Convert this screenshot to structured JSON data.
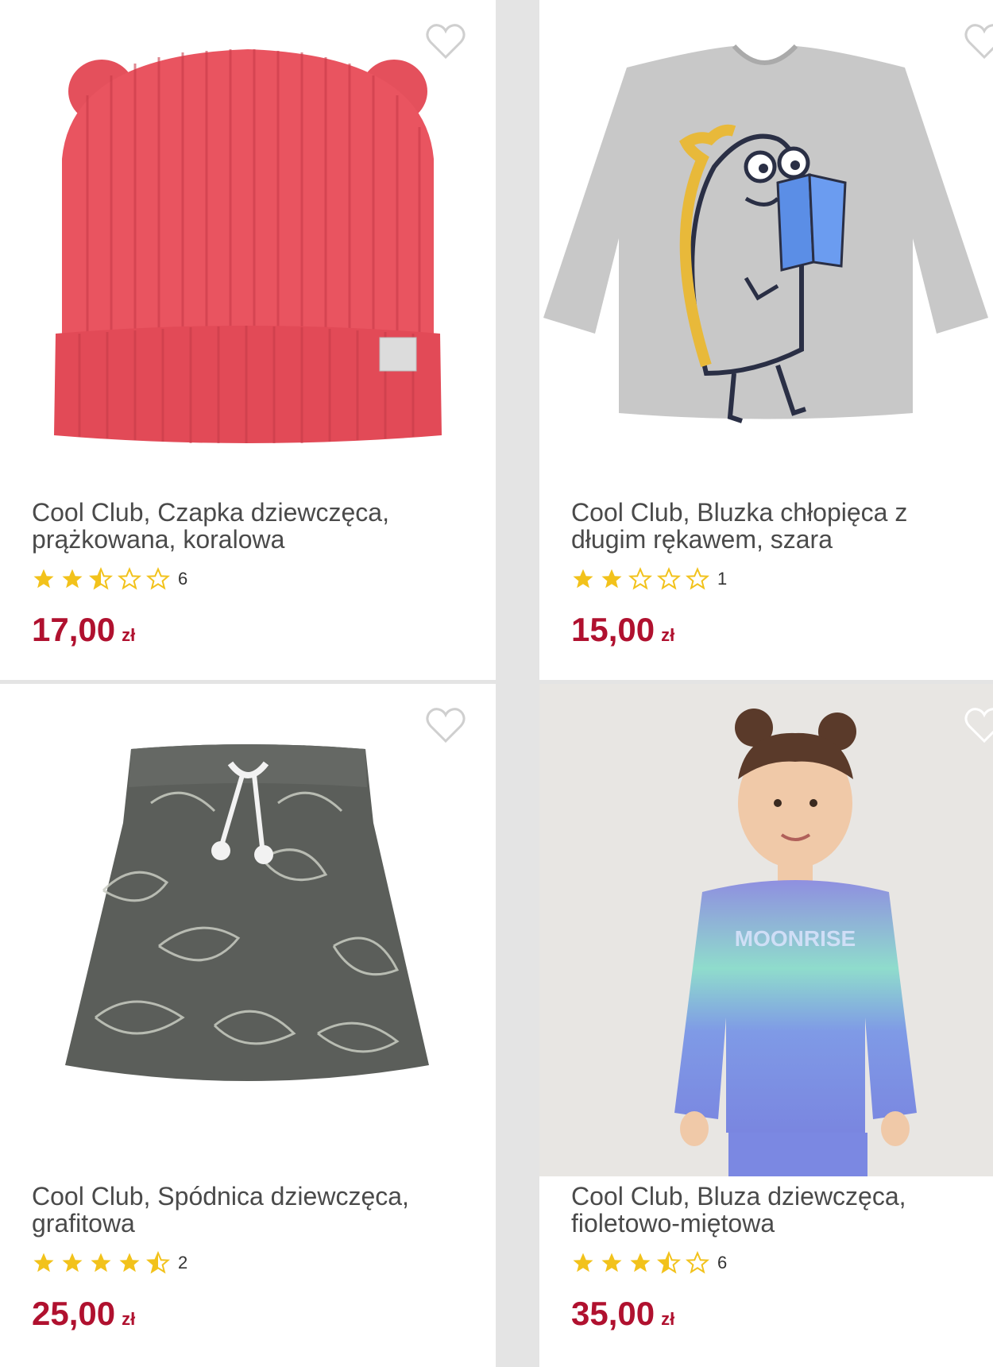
{
  "products": [
    {
      "title_line1": "Cool Club, Czapka dziewczęca,",
      "title_line2": "prążkowana, koralowa",
      "rating": 2.5,
      "review_count": "6",
      "price": "17,00",
      "currency": "zł",
      "image": "coral-knit-hat-with-ears"
    },
    {
      "title_line1": "Cool Club, Bluzka chłopięca z",
      "title_line2": "długim rękawem, szara",
      "rating": 2,
      "review_count": "1",
      "price": "15,00",
      "currency": "zł",
      "image": "grey-longsleeve-dino-reading"
    },
    {
      "title_line1": "Cool Club, Spódnica dziewczęca,",
      "title_line2": "grafitowa",
      "rating": 4.5,
      "review_count": "2",
      "price": "25,00",
      "currency": "zł",
      "image": "graphite-leaf-print-skirt"
    },
    {
      "title_line1": "Cool Club, Bluza dziewczęca,",
      "title_line2": "fioletowo-miętowa",
      "rating": 3.5,
      "review_count": "6",
      "price": "35,00",
      "currency": "zł",
      "image": "girl-violet-mint-sweatshirt"
    }
  ],
  "colors": {
    "price": "#b0112f",
    "star": "#f2c21b",
    "star_empty_stroke": "#f2c21b",
    "heart_stroke": "#cfcfcf"
  },
  "icons": {
    "wishlist": "heart-outline-icon",
    "star_full": "star-full-icon",
    "star_half": "star-half-icon",
    "star_empty": "star-empty-icon"
  }
}
